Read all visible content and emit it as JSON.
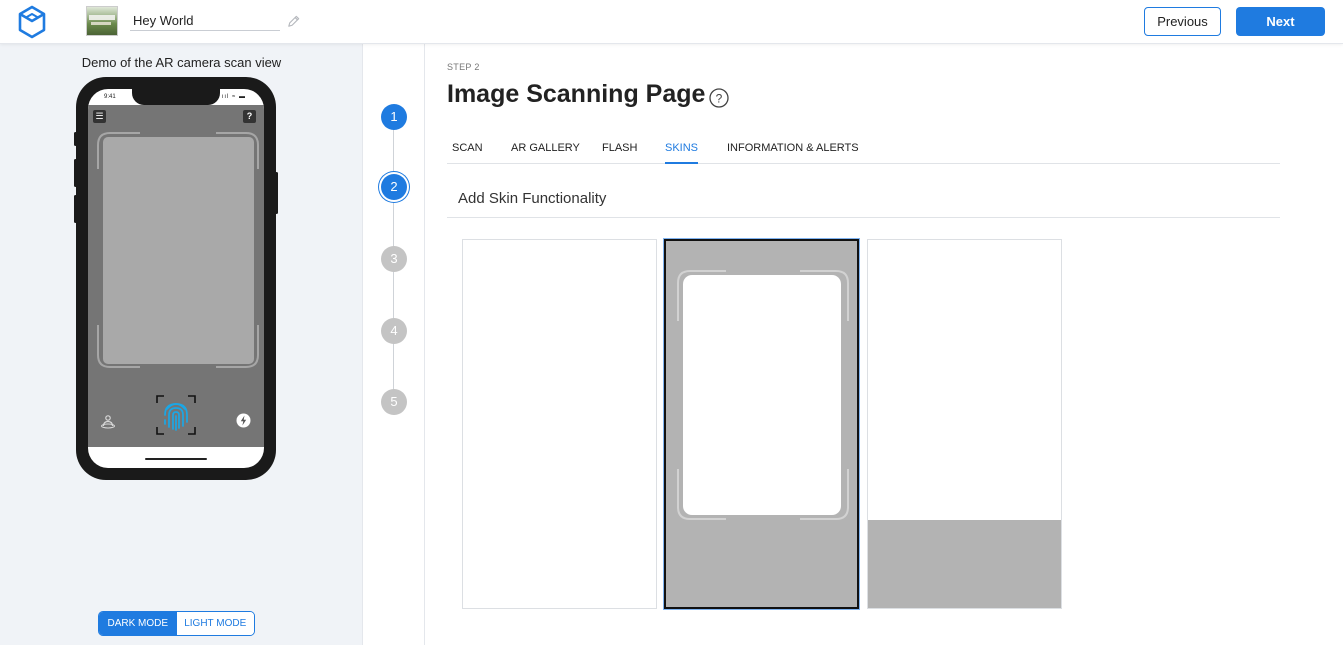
{
  "header": {
    "project_name": "Hey World",
    "previous_label": "Previous",
    "next_label": "Next"
  },
  "preview": {
    "caption": "Demo of the AR camera scan view",
    "status_time": "9:41",
    "status_icons": "ııl ≈ ▬",
    "menu_glyph": "☰",
    "help_glyph": "?",
    "mode_dark_label": "DARK MODE",
    "mode_light_label": "LIGHT MODE",
    "selected_mode": "DARK MODE"
  },
  "stepper": {
    "steps": [
      "1",
      "2",
      "3",
      "4",
      "5"
    ],
    "current_step": "2"
  },
  "main": {
    "step_label": "STEP 2",
    "title": "Image Scanning Page",
    "help_glyph": "?",
    "tabs": [
      {
        "label": "SCAN",
        "active": false
      },
      {
        "label": "AR GALLERY",
        "active": false
      },
      {
        "label": "FLASH",
        "active": false
      },
      {
        "label": "SKINS",
        "active": true
      },
      {
        "label": "INFORMATION & ALERTS",
        "active": false
      }
    ],
    "section_title": "Add Skin Functionality",
    "skins": [
      {
        "name": "blank",
        "selected": false
      },
      {
        "name": "scan-frame",
        "selected": true
      },
      {
        "name": "bottom-panel",
        "selected": false
      }
    ]
  },
  "colors": {
    "accent": "#1f7be0",
    "step_inactive": "#c4c4c4",
    "camera_gray": "#757575",
    "skin_gray": "#b3b3b3"
  },
  "icons": [
    "logo-cube-icon",
    "pencil-icon",
    "menu-icon",
    "help-icon",
    "fingerprint-icon",
    "ar-person-icon",
    "flash-icon",
    "question-circle-icon"
  ]
}
